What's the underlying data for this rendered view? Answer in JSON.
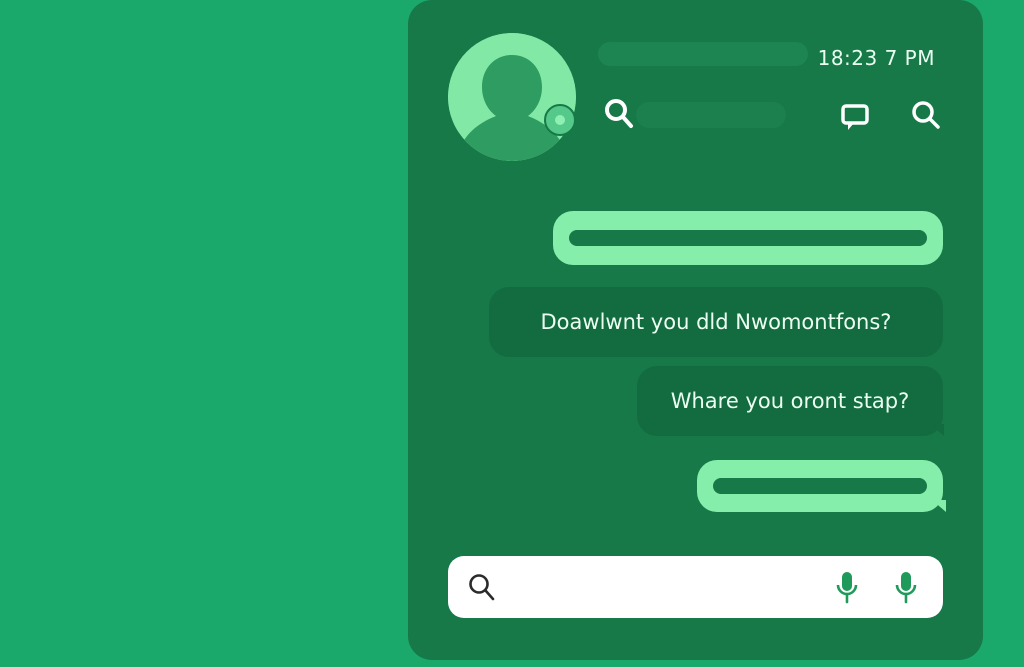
{
  "status": {
    "time": "18:23 7 PM"
  },
  "contact": {
    "has_presence": true
  },
  "header_icons": [
    "search-icon",
    "chat-icon",
    "search-icon"
  ],
  "messages": [
    {
      "side": "right",
      "style": "redacted"
    },
    {
      "side": "left",
      "style": "text",
      "text": "Doawlwnt you dld Nwomontfons?"
    },
    {
      "side": "right",
      "style": "text",
      "text": "Whare you oront stap?"
    },
    {
      "side": "right",
      "style": "redacted"
    }
  ],
  "composer": {
    "placeholder": "",
    "icons": [
      "search-icon",
      "mic-icon",
      "mic-icon"
    ]
  },
  "colors": {
    "background": "#1aa96a",
    "panel": "#177848",
    "bubble_light": "#86eeab",
    "bubble_dark": "#136c3f",
    "input": "#ffffff",
    "mic": "#1f9a5a"
  }
}
